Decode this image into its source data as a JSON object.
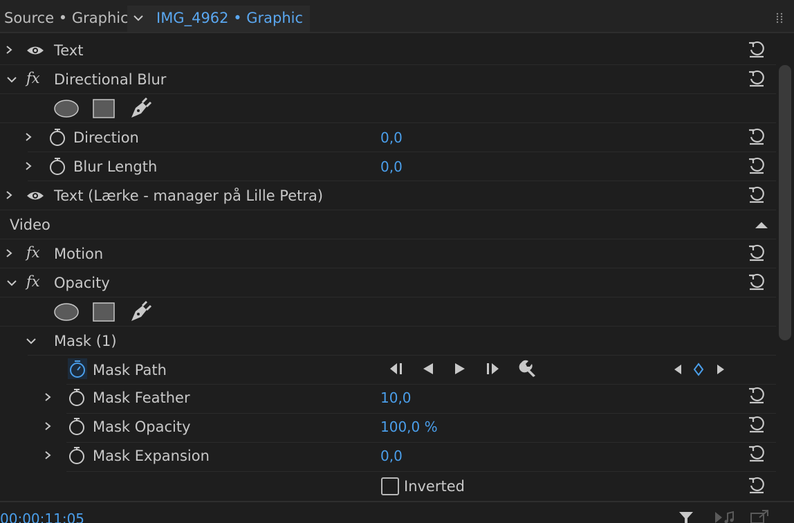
{
  "header": {
    "source_label": "Source • Graphic",
    "clip_label": "IMG_4962 • Graphic"
  },
  "rows": {
    "text1": "Text",
    "directional_blur": "Directional Blur",
    "direction": {
      "label": "Direction",
      "value": "0,0"
    },
    "blur_length": {
      "label": "Blur Length",
      "value": "0,0"
    },
    "text2": "Text (Lærke - manager på Lille Petra)",
    "video_section": "Video",
    "motion": "Motion",
    "opacity": "Opacity",
    "mask": "Mask (1)",
    "mask_path": "Mask Path",
    "mask_feather": {
      "label": "Mask Feather",
      "value": "10,0"
    },
    "mask_opacity": {
      "label": "Mask Opacity",
      "value": "100,0 %"
    },
    "mask_expansion": {
      "label": "Mask Expansion",
      "value": "0,0"
    },
    "inverted": "Inverted"
  },
  "footer": {
    "timecode": "00:00:11:05"
  },
  "icons": {
    "visibility": "eye-icon",
    "effect": "fx-icon",
    "stopwatch": "stopwatch-icon",
    "reset": "reset-icon",
    "ellipse_mask": "ellipse-mask-icon",
    "rect_mask": "rectangle-mask-icon",
    "pen_mask": "pen-mask-icon",
    "wrench": "wrench-icon",
    "filter": "filter-icon"
  },
  "colors": {
    "accent": "#4a9eea",
    "background": "#1e1e1e",
    "text": "#c8c8c8"
  }
}
